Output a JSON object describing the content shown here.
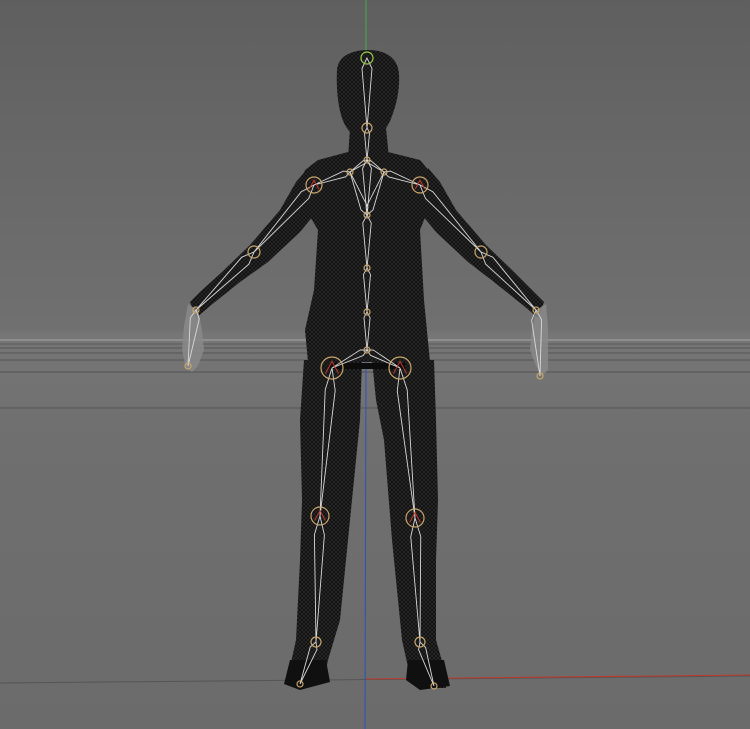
{
  "viewport": {
    "background_top": "#5e5e5e",
    "background_bottom": "#6d6d6d",
    "grid_color": "#4a4a4a",
    "horizon_color": "#9a9a9a",
    "axis_x_color": "#c0392b",
    "axis_y_color": "#2ecc71",
    "axis_z_color": "#2c4fc7",
    "mesh_color": "#151515",
    "wire_color": "#3a3a3a",
    "bone_color": "#d9d9d9",
    "joint_color": "#c9a66b",
    "head_joint_color": "#9ad04a"
  },
  "icons": {
    "character": "character-mesh-icon",
    "skeleton": "skeleton-rig-icon"
  }
}
